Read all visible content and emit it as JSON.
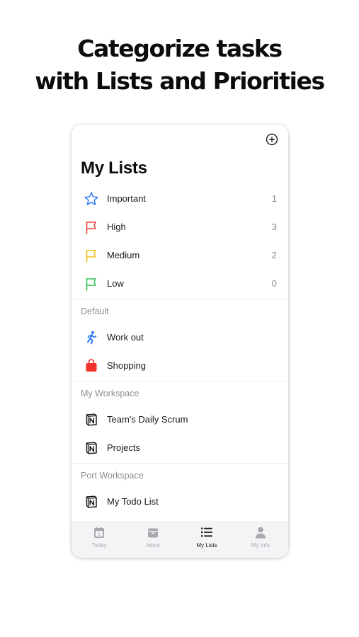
{
  "headline": {
    "line1": "Categorize tasks",
    "line2": "with Lists and Priorities"
  },
  "header": {
    "title": "My Lists",
    "add_icon": "plus-circle-icon"
  },
  "priority_lists": [
    {
      "label": "Important",
      "count": "1",
      "icon": "star-icon",
      "color": "#2f7cf6"
    },
    {
      "label": "High",
      "count": "3",
      "icon": "flag-icon",
      "color": "#e8413a"
    },
    {
      "label": "Medium",
      "count": "2",
      "icon": "flag-icon",
      "color": "#f2c218"
    },
    {
      "label": "Low",
      "count": "0",
      "icon": "flag-icon",
      "color": "#35c25a"
    }
  ],
  "sections": [
    {
      "title": "Default",
      "items": [
        {
          "label": "Work out",
          "icon": "running-person-icon",
          "color": "#2f7cf6"
        },
        {
          "label": "Shopping",
          "icon": "shopping-bag-icon",
          "color": "#f0332b"
        }
      ]
    },
    {
      "title": "My Workspace",
      "items": [
        {
          "label": "Team's Daily Scrum",
          "icon": "notion-icon"
        },
        {
          "label": "Projects",
          "icon": "notion-icon"
        }
      ]
    },
    {
      "title": "Port Workspace",
      "items": [
        {
          "label": "My Todo List",
          "icon": "notion-icon"
        }
      ]
    }
  ],
  "tabbar": {
    "tabs": [
      {
        "label": "Today",
        "icon": "calendar-icon",
        "badge": "9"
      },
      {
        "label": "Inbox",
        "icon": "inbox-tray-icon"
      },
      {
        "label": "My Lists",
        "icon": "list-icon",
        "active": true
      },
      {
        "label": "My Info",
        "icon": "person-icon"
      }
    ]
  },
  "colors": {
    "tab_inactive": "#a7a9ad",
    "tab_active": "#1c1c1e",
    "section_text": "#8e8e93"
  }
}
